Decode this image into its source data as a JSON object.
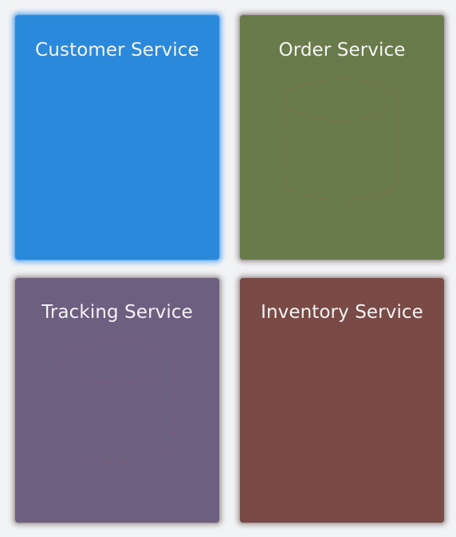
{
  "tiles": {
    "customer": {
      "title": "Customer Service",
      "color": "#2b89dc",
      "has_database": false
    },
    "order": {
      "title": "Order Service",
      "color": "#6a7b4b",
      "has_database": true,
      "database_icon": "database-cylinder-icon"
    },
    "tracking": {
      "title": "Tracking Service",
      "color": "#6c5f80",
      "has_database": true,
      "database_icon": "database-cylinder-icon"
    },
    "inventory": {
      "title": "Inventory Service",
      "color": "#794a46",
      "has_database": false
    }
  }
}
